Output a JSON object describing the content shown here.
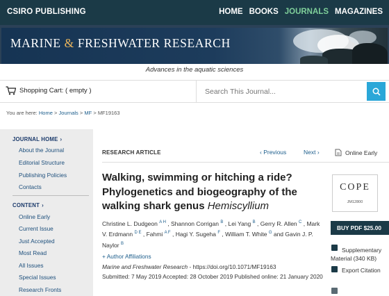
{
  "topbar": {
    "brand": "CSIRO PUBLISHING",
    "nav": [
      "HOME",
      "BOOKS",
      "JOURNALS",
      "MAGAZINES"
    ],
    "active_nav": "JOURNALS"
  },
  "banner": {
    "title_part1": "MARINE",
    "title_amp": "&",
    "title_part2": "FRESHWATER RESEARCH",
    "tagline": "Advances in the aquatic sciences"
  },
  "toolbar": {
    "cart_label": "Shopping Cart: ( empty )",
    "search_placeholder": "Search This Journal..."
  },
  "breadcrumb": {
    "prefix": "You are here:",
    "items": [
      "Home",
      "Journals",
      "MF",
      "MF19163"
    ],
    "separator": ">"
  },
  "sidebar": {
    "sections": [
      {
        "heading": "JOURNAL HOME",
        "items": [
          "About the Journal",
          "Editorial Structure",
          "Publishing Policies",
          "Contacts"
        ]
      },
      {
        "heading": "CONTENT",
        "items": [
          "Online Early",
          "Current Issue",
          "Just Accepted",
          "Most Read",
          "All Issues",
          "Special Issues",
          "Research Fronts"
        ]
      }
    ]
  },
  "article": {
    "type": "RESEARCH ARTICLE",
    "prev_label": "Previous",
    "next_label": "Next",
    "online_early_label": "Online Early",
    "title_main": "Walking, swimming or hitching a ride? Phylogenetics and biogeography of the walking shark genus",
    "title_genus": "Hemiscyllium",
    "authors": [
      {
        "name": "Christine L. Dudgeon",
        "sup": "A H"
      },
      {
        "name": "Shannon Corrigan",
        "sup": "B"
      },
      {
        "name": "Lei Yang",
        "sup": "B"
      },
      {
        "name": "Gerry R. Allen",
        "sup": "C"
      },
      {
        "name": "Mark V. Erdmann",
        "sup": "D E"
      },
      {
        "name": "Fahmi",
        "sup": "A F"
      },
      {
        "name": "Hagi Y. Sugeha",
        "sup": "F"
      },
      {
        "name": "William T. White",
        "sup": "G"
      },
      {
        "name": "Gavin J. P. Naylor",
        "sup": "B"
      }
    ],
    "affiliations_label": "+ Author Affiliations",
    "journal_name": "Marine and Freshwater Research",
    "doi_text": "- https://doi.org/10.1071/MF19163",
    "dates_text": "Submitted: 7 May 2019  Accepted: 28 October 2019  Published online: 21 January 2020"
  },
  "right": {
    "cope_text": "COPE",
    "cope_id": "JM12800",
    "buy_label": "BUY PDF $25.00",
    "supplementary_label": "Supplementary Material (340 KB)",
    "export_label": "Export Citation"
  },
  "colors": {
    "topbar": "#1b3a47",
    "active_nav": "#7fcf9a",
    "link": "#1d5e8c",
    "search_button": "#2aa7d8",
    "sidebar_bg": "#ececec"
  }
}
